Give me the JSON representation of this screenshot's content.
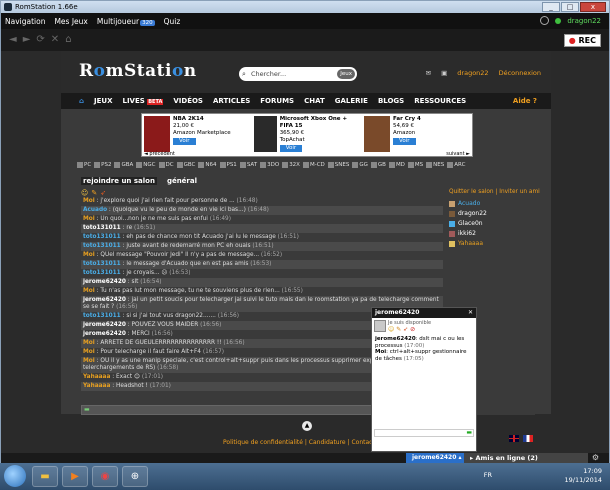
{
  "window": {
    "title": "RomStation 1.66e"
  },
  "menu": {
    "items": [
      "Navigation",
      "Mes Jeux",
      "Multijoueur",
      "Quiz"
    ],
    "multijoueur_badge": "320",
    "username": "dragon22"
  },
  "toolbar": {
    "rec_label": "REC"
  },
  "site": {
    "logo_prefix": "R",
    "logo_o": "o",
    "logo_mid": "mStati",
    "logo_o2": "o",
    "logo_suffix": "n",
    "search_placeholder": "Chercher...",
    "search_button": "Jeux",
    "user": "dragon22",
    "logout": "Déconnexion"
  },
  "tabs": {
    "items": [
      "JEUX",
      "LIVES",
      "VIDÉOS",
      "ARTICLES",
      "FORUMS",
      "CHAT",
      "GALERIE",
      "BLOGS",
      "RESSOURCES"
    ],
    "lives_badge": "BETA",
    "aide": "Aide"
  },
  "carousel": {
    "products": [
      {
        "title": "NBA 2K14",
        "price": "21,00 €",
        "store": "Amazon Marketplace",
        "cta": "Voir",
        "color": "#8b1a1a"
      },
      {
        "title": "Microsoft Xbox One + FIFA 15",
        "price": "365,90 €",
        "store": "TopAchat",
        "cta": "Voir",
        "color": "#2a2a2a"
      },
      {
        "title": "Far Cry 4",
        "price": "54,69 €",
        "store": "Amazon",
        "cta": "Voir",
        "color": "#7a4a2a"
      }
    ],
    "prev": "◄ précédent",
    "next": "suivant ►"
  },
  "consoles": [
    "PC",
    "PS2",
    "GBA",
    "NGC",
    "DC",
    "GBC",
    "N64",
    "PS1",
    "SAT",
    "3DO",
    "32X",
    "M-CD",
    "SNES",
    "GG",
    "GB",
    "MD",
    "MS",
    "NES",
    "ARC"
  ],
  "chat": {
    "tabs": [
      "rejoindre un salon",
      "général"
    ],
    "links": "Quitter le salon | Inviter un ami",
    "messages": [
      {
        "user": "Moi",
        "text": " : j'explore quoi j'ai rien fait pour personne de ...",
        "time": "(16:48)",
        "cls": "u-moi"
      },
      {
        "user": "Acuado",
        "text": " : (quoique vu le peu de monde en vie ici bas...)",
        "time": "(16:48)",
        "cls": "u-acuado"
      },
      {
        "user": "Moi",
        "text": " : Un quoi...non je ne me suis pas enfui",
        "time": "(16:49)",
        "cls": "u-moi"
      },
      {
        "user": "toto131011",
        "text": " : re",
        "time": "(16:51)",
        "cls": "u-jerome"
      },
      {
        "user": "toto131011",
        "text": " : eh pas de chance mon tit Acuado j'ai lu le message",
        "time": "(16:51)",
        "cls": "u-toto"
      },
      {
        "user": "toto131011",
        "text": " : juste avant de redemarré mon PC eh ouais",
        "time": "(16:51)",
        "cls": "u-toto"
      },
      {
        "user": "Moi",
        "text": " : QUel message \"Pouvoir Jedi\" Il n'y a pas de message...",
        "time": "(16:52)",
        "cls": "u-moi"
      },
      {
        "user": "toto131011",
        "text": " : le message d'Acuado que en est pas amis",
        "time": "(16:53)",
        "cls": "u-toto"
      },
      {
        "user": "toto131011",
        "text": " : je croyais... 😕",
        "time": "(16:53)",
        "cls": "u-toto"
      },
      {
        "user": "jerome62420",
        "text": " : slt",
        "time": "(16:54)",
        "cls": "u-jerome"
      },
      {
        "user": "Moi",
        "text": " : Tu n'as pas lut mon message, tu ne te souviens plus de rien...",
        "time": "(16:55)",
        "cls": "u-moi"
      },
      {
        "user": "jerome62420",
        "text": " : jai un petit soucis pour telecharger jai suivi le tuto mais dan le roomstation ya pa de telecharge comment se se fait ?",
        "time": "(16:56)",
        "cls": "u-jerome"
      },
      {
        "user": "toto131011",
        "text": " : si si j'ai tout vus dragon22.......",
        "time": "(16:56)",
        "cls": "u-toto"
      },
      {
        "user": "jerome62420",
        "text": " : POUVEZ VOUS MAIDER",
        "time": "(16:56)",
        "cls": "u-jerome"
      },
      {
        "user": "jerome62420",
        "text": " : MERCI",
        "time": "(16:56)",
        "cls": "u-jerome"
      },
      {
        "user": "Moi",
        "text": " : ARRETE DE GUEULERRRRRRRRRRRRRR !!",
        "time": "(16:56)",
        "cls": "u-moi"
      },
      {
        "user": "Moi",
        "text": " : Pour telecharge il faut faire Alt+F4",
        "time": "(16:57)",
        "cls": "u-moi"
      },
      {
        "user": "Moi",
        "text": " : OU il y as une manip speciale, c'est control+alt+suppr puis dans les processus supprimer explorer.exe (sinon les telerchargements de RS)",
        "time": "(16:58)",
        "cls": "u-moi"
      },
      {
        "user": "Yahaaaa",
        "text": " : Exact 😊",
        "time": "(17:01)",
        "cls": "u-yahaaaa"
      },
      {
        "user": "Yahaaaa",
        "text": " : Headshot !",
        "time": "(17:01)",
        "cls": "u-yahaaaa"
      }
    ],
    "users": [
      "Acuado",
      "dragon22",
      "Glace0n",
      "ikki62",
      "Yahaaaa"
    ]
  },
  "footer": {
    "links": "Politique de confidentialité | Candidature | Contact"
  },
  "pm": {
    "title": "jerome62420",
    "status": "Je suis disponible",
    "messages": [
      {
        "user": "jerome62420",
        "text": ": dslt mai c ou les processus",
        "time": "(17:00)"
      },
      {
        "user": "Moi",
        "text": ": ctrl+alt+suppr gestionnaire de tâches",
        "time": "(17:05)"
      }
    ]
  },
  "dock": {
    "pm_tab": "jerome62420",
    "friends": "Amis en ligne (2)"
  },
  "taskbar": {
    "lang": "FR",
    "time": "17:09",
    "date": "19/11/2014"
  }
}
